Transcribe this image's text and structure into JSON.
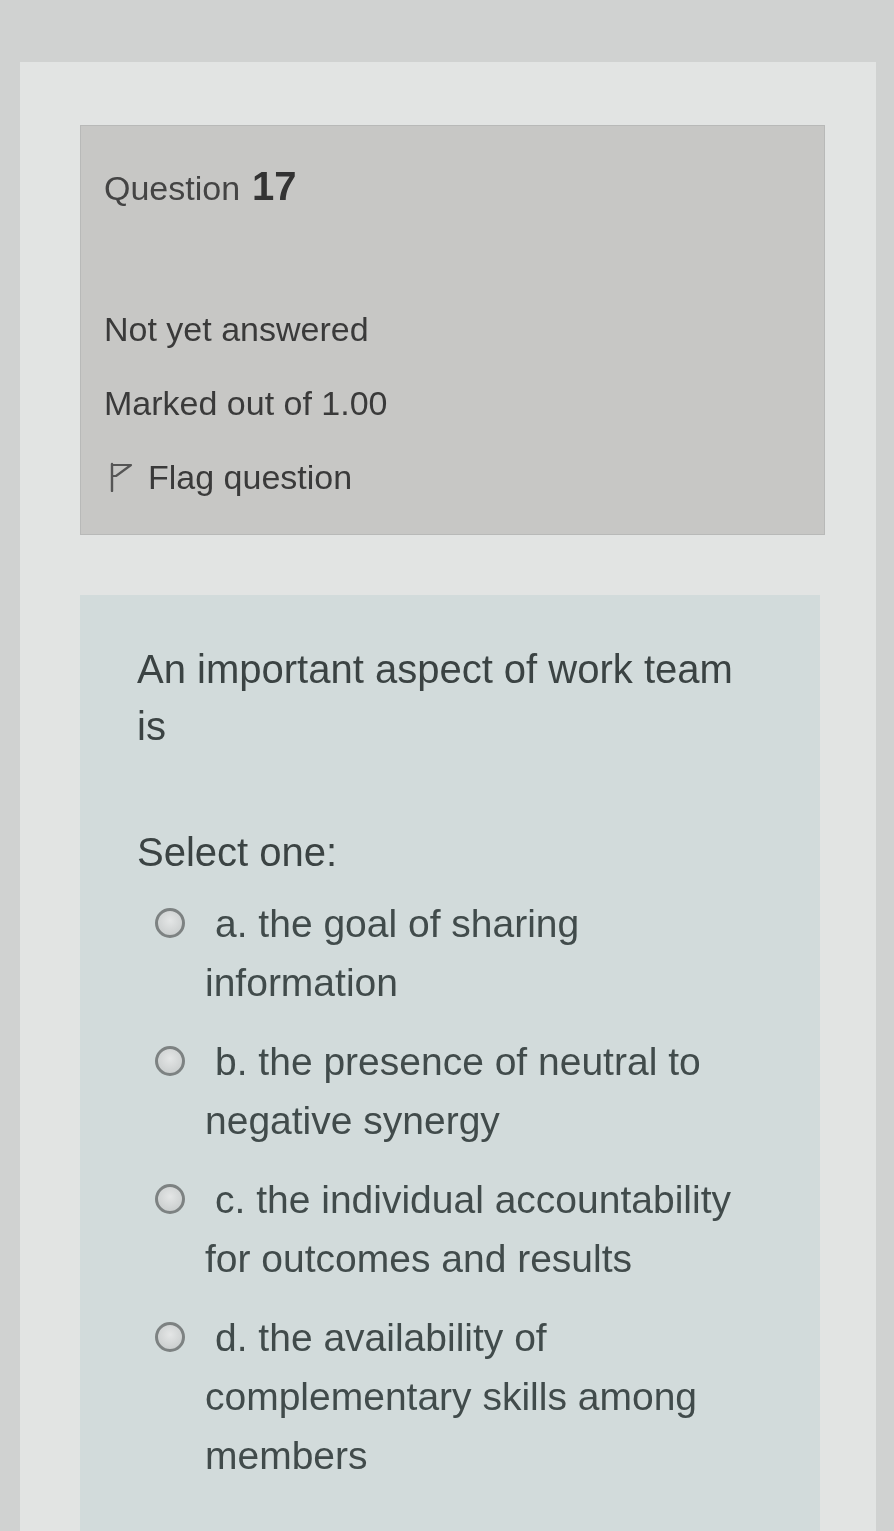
{
  "question_info": {
    "label": "Question",
    "number": "17",
    "state": "Not yet answered",
    "mark": "Marked out of 1.00",
    "flag": {
      "label": "Flag question",
      "flagged": false
    }
  },
  "question_content": {
    "text": "An important aspect of work team is",
    "prompt": "Select one:",
    "options": [
      {
        "label": "a. the goal of sharing information",
        "selected": false
      },
      {
        "label": "b. the presence of neutral to negative synergy",
        "selected": false
      },
      {
        "label": "c. the individual accountability for outcomes and results",
        "selected": false
      },
      {
        "label": "d. the availability of complementary skills among members",
        "selected": false
      }
    ]
  }
}
